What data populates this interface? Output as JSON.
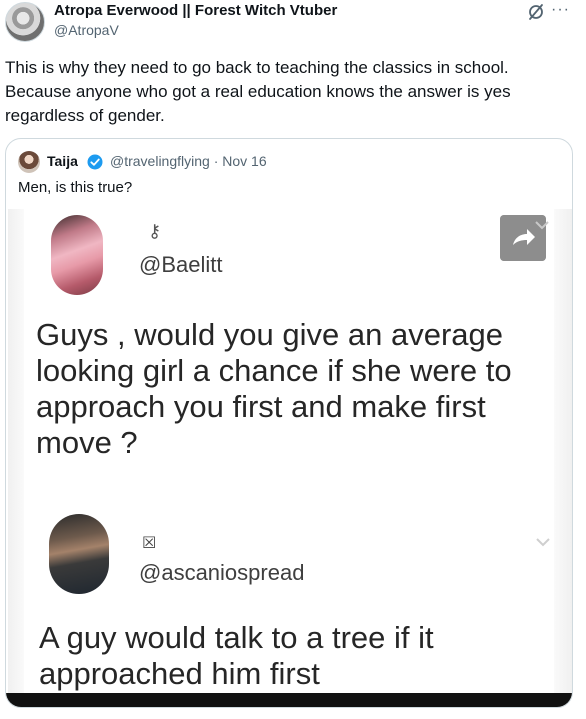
{
  "post": {
    "display_name": "Atropa Everwood || Forest Witch Vtuber",
    "handle": "@AtropaV",
    "text": "This is why they need to go back to teaching the classics in school. Because anyone who got a real education knows the answer is yes regardless of gender.",
    "grok_icon": "grok-icon",
    "more_icon": "more-icon",
    "more_symbol": "···"
  },
  "quote": {
    "name": "Taija",
    "meta": "@travelingflying · Nov 16",
    "text": "Men, is this true?",
    "verified_color": "#1d9bf0",
    "screenshot": {
      "first_user": "@Baelitt",
      "first_glyph": "⚷",
      "first_text": "Guys , would you give an average looking girl a chance if she were to approach you first and make first move ?",
      "second_user": "@ascaniospread",
      "second_glyph": "☒",
      "second_text": "A guy would talk to a tree if it approached him first"
    }
  },
  "colors": {
    "text_primary": "#0f1419",
    "text_secondary": "#536471",
    "border": "#cfd9de",
    "accent": "#1d9bf0"
  }
}
